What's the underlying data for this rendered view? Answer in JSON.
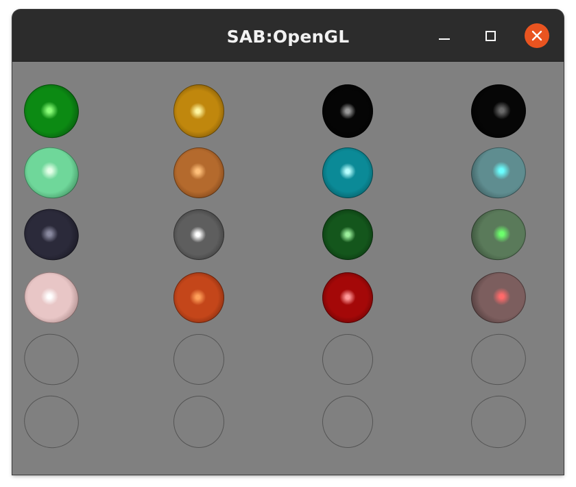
{
  "window": {
    "title": "SAB:OpenGL"
  },
  "controls": {
    "minimize_icon": "minimize-icon",
    "maximize_icon": "maximize-icon",
    "close_icon": "close-icon",
    "close_color": "#e95420"
  },
  "canvas": {
    "background": "#808080",
    "spheres": [
      {
        "row": 0,
        "col": 0,
        "base": "#0c8a13",
        "highlight": "#8cff7a",
        "dark": "#03320a"
      },
      {
        "row": 0,
        "col": 1,
        "base": "#c0870d",
        "highlight": "#fff6a0",
        "dark": "#4a3202"
      },
      {
        "row": 0,
        "col": 2,
        "base": "#050505",
        "highlight": "#9a9a9a",
        "dark": "#000000"
      },
      {
        "row": 0,
        "col": 3,
        "base": "#060606",
        "highlight": "#6a6a6a",
        "dark": "#000000"
      },
      {
        "row": 1,
        "col": 0,
        "base": "#6fd79a",
        "highlight": "#e4ffe8",
        "dark": "#1f5b36"
      },
      {
        "row": 1,
        "col": 1,
        "base": "#b46a2d",
        "highlight": "#ffc07a",
        "dark": "#4c2409"
      },
      {
        "row": 1,
        "col": 2,
        "base": "#0b8a97",
        "highlight": "#b8ffff",
        "dark": "#033a40"
      },
      {
        "row": 1,
        "col": 3,
        "base": "#5f8d90",
        "highlight": "#6affff",
        "dark": "#233739"
      },
      {
        "row": 2,
        "col": 0,
        "base": "#2b2a3a",
        "highlight": "#8a8aa0",
        "dark": "#0f0e16"
      },
      {
        "row": 2,
        "col": 1,
        "base": "#5e5e5e",
        "highlight": "#ffffff",
        "dark": "#222222"
      },
      {
        "row": 2,
        "col": 2,
        "base": "#14561c",
        "highlight": "#9cf09c",
        "dark": "#042007"
      },
      {
        "row": 2,
        "col": 3,
        "base": "#5a7a5a",
        "highlight": "#6cff6c",
        "dark": "#243424"
      },
      {
        "row": 3,
        "col": 0,
        "base": "#e8c6c6",
        "highlight": "#ffffff",
        "dark": "#7c5d5d"
      },
      {
        "row": 3,
        "col": 1,
        "base": "#c4461a",
        "highlight": "#ffa05a",
        "dark": "#4e1606"
      },
      {
        "row": 3,
        "col": 2,
        "base": "#a40808",
        "highlight": "#ff9a9a",
        "dark": "#3e0202"
      },
      {
        "row": 3,
        "col": 3,
        "base": "#7c5e5e",
        "highlight": "#ff6a6a",
        "dark": "#2e2222"
      },
      {
        "row": 4,
        "col": 0,
        "base": "#a30b0b",
        "highlight": "#ffa4a4",
        "dark": "#3e0202"
      },
      {
        "row": 4,
        "col": 1,
        "base": "#c09438",
        "highlight": "#fff27a",
        "dark": "#4c3610"
      },
      {
        "row": 4,
        "col": 2,
        "base": "#8c8c8c",
        "highlight": "#ffffff",
        "dark": "#3a3a3a"
      },
      {
        "row": 4,
        "col": 3,
        "base": "#8e8e8e",
        "highlight": "#ffffff",
        "dark": "#2c2c2c"
      },
      {
        "row": 5,
        "col": 0,
        "base": "#5fbcb8",
        "highlight": "#d6ffff",
        "dark": "#1e4948"
      },
      {
        "row": 5,
        "col": 1,
        "base": "#7a7a7a",
        "highlight": "#ffffff",
        "dark": "#2e2e2e"
      },
      {
        "row": 5,
        "col": 2,
        "base": "#9a9a08",
        "highlight": "#ffff80",
        "dark": "#3a3a02"
      },
      {
        "row": 5,
        "col": 3,
        "base": "#74745e",
        "highlight": "#ffff66",
        "dark": "#2a2a1e"
      }
    ]
  }
}
